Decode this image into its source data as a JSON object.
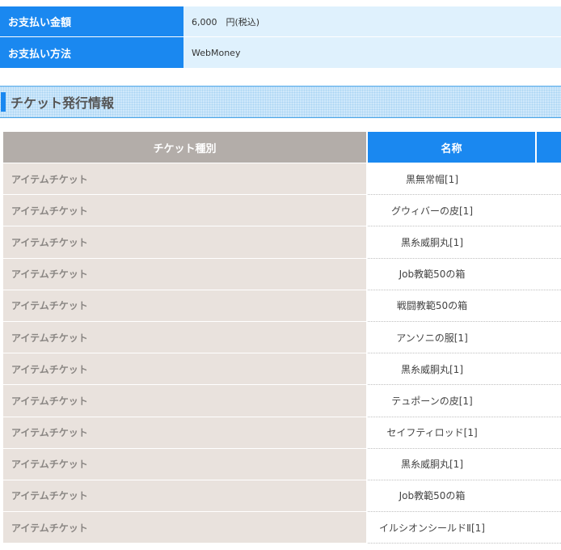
{
  "payment": {
    "rows": [
      {
        "label": "お支払い金額",
        "value": "6,000　円(税込)"
      },
      {
        "label": "お支払い方法",
        "value": "WebMoney"
      }
    ]
  },
  "section": {
    "title": "チケット発行情報"
  },
  "tickets": {
    "headers": {
      "type": "チケット種別",
      "name": "名称"
    },
    "rows": [
      {
        "type": "アイテムチケット",
        "name": "黒無常帽[1]"
      },
      {
        "type": "アイテムチケット",
        "name": "グウィバーの皮[1]"
      },
      {
        "type": "アイテムチケット",
        "name": "黒糸威胴丸[1]"
      },
      {
        "type": "アイテムチケット",
        "name": "Job教範50の箱"
      },
      {
        "type": "アイテムチケット",
        "name": "戦闘教範50の箱"
      },
      {
        "type": "アイテムチケット",
        "name": "アンソニの服[1]"
      },
      {
        "type": "アイテムチケット",
        "name": "黒糸威胴丸[1]"
      },
      {
        "type": "アイテムチケット",
        "name": "テュポーンの皮[1]"
      },
      {
        "type": "アイテムチケット",
        "name": "セイフティロッド[1]"
      },
      {
        "type": "アイテムチケット",
        "name": "黒糸威胴丸[1]"
      },
      {
        "type": "アイテムチケット",
        "name": "Job教範50の箱"
      },
      {
        "type": "アイテムチケット",
        "name": "イルシオンシールドⅡ[1]"
      }
    ]
  },
  "colors": {
    "accent_blue": "#1a88f0",
    "value_bg": "#dff1fd",
    "type_header_bg": "#b3ada9",
    "type_cell_bg": "#e9e2dd"
  }
}
